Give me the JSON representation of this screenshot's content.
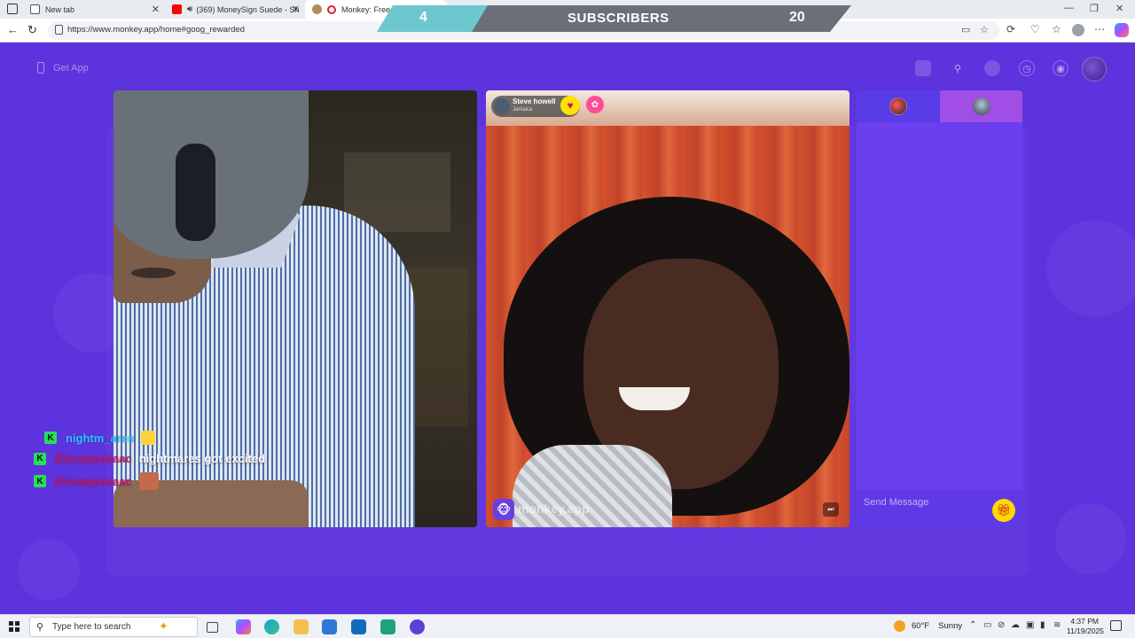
{
  "browser": {
    "tabs": [
      {
        "title": "New tab",
        "active": false
      },
      {
        "title": "(369) MoneySign Suede - Sh",
        "active": false,
        "audio": true
      },
      {
        "title": "Monkey: Free Live V",
        "active": true,
        "recording": true
      }
    ],
    "url": "https://www.monkey.app/home#goog_rewarded"
  },
  "overlay": {
    "left_count": "4",
    "label": "SUBSCRIBERS",
    "right_count": "20",
    "left_color": "#6cc7cf",
    "bar_color": "#6b6f78"
  },
  "page": {
    "background": "#5d33dd",
    "get_app_label": "Get App",
    "top_icons": [
      "gift-box-icon",
      "search-icon",
      "coin-icon",
      "history-icon",
      "eye-icon"
    ],
    "left_chat": [
      {
        "badge": "K",
        "username": "nightm_ares",
        "username_color": "#29c4ff",
        "message": "",
        "emoji": "surprised-emoji"
      },
      {
        "badge": "K",
        "username": "Elcompaisaac",
        "username_color": "#c2185b",
        "message": "nightmares got excited",
        "emoji": ""
      },
      {
        "badge": "K",
        "username": "Elcompaisaac",
        "username_color": "#c2185b",
        "message": "",
        "emoji": "face-emoji"
      }
    ],
    "partner": {
      "name": "Steve howell",
      "location": "Jamaica"
    },
    "watermark": "monkey.app",
    "chat_panel": {
      "placeholder": "Send Message"
    }
  },
  "taskbar": {
    "search_placeholder": "Type here to search",
    "weather_temp": "60°F",
    "weather_text": "Sunny",
    "time": "4:37 PM",
    "date": "11/19/2025"
  }
}
